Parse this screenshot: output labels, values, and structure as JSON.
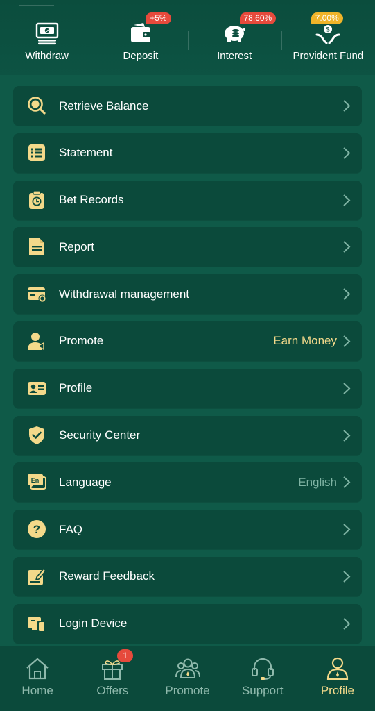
{
  "quick_actions": [
    {
      "label": "Withdraw",
      "icon": "withdraw-icon",
      "badge": ""
    },
    {
      "label": "Deposit",
      "icon": "wallet-icon",
      "badge": "+5%"
    },
    {
      "label": "Interest",
      "icon": "piggy-bank-icon",
      "badge": "78.60%"
    },
    {
      "label": "Provident Fund",
      "icon": "hands-coin-icon",
      "badge": "7.00%"
    }
  ],
  "menu": [
    {
      "label": "Retrieve Balance",
      "icon": "search-coin-icon",
      "value": ""
    },
    {
      "label": "Statement",
      "icon": "list-icon",
      "value": ""
    },
    {
      "label": "Bet Records",
      "icon": "clock-clipboard-icon",
      "value": ""
    },
    {
      "label": "Report",
      "icon": "document-icon",
      "value": ""
    },
    {
      "label": "Withdrawal management",
      "icon": "card-gear-icon",
      "value": ""
    },
    {
      "label": "Promote",
      "icon": "user-speaker-icon",
      "value": "Earn Money"
    },
    {
      "label": "Profile",
      "icon": "id-card-icon",
      "value": ""
    },
    {
      "label": "Security Center",
      "icon": "shield-check-icon",
      "value": ""
    },
    {
      "label": "Language",
      "icon": "language-icon",
      "value": "English"
    },
    {
      "label": "FAQ",
      "icon": "question-icon",
      "value": ""
    },
    {
      "label": "Reward Feedback",
      "icon": "edit-note-icon",
      "value": ""
    },
    {
      "label": "Login Device",
      "icon": "devices-icon",
      "value": ""
    }
  ],
  "bottom_nav": [
    {
      "label": "Home",
      "icon": "home-icon",
      "badge": "",
      "active": false
    },
    {
      "label": "Offers",
      "icon": "gift-icon",
      "badge": "1",
      "active": false
    },
    {
      "label": "Promote",
      "icon": "group-icon",
      "badge": "",
      "active": false
    },
    {
      "label": "Support",
      "icon": "headset-icon",
      "badge": "",
      "active": false
    },
    {
      "label": "Profile",
      "icon": "person-icon",
      "badge": "",
      "active": true
    }
  ],
  "colors": {
    "background": "#0f5a48",
    "card": "#0b4a3b",
    "accent_gold": "#f3d98a",
    "badge_red": "#e64a3c",
    "badge_gold": "#f0b429"
  }
}
